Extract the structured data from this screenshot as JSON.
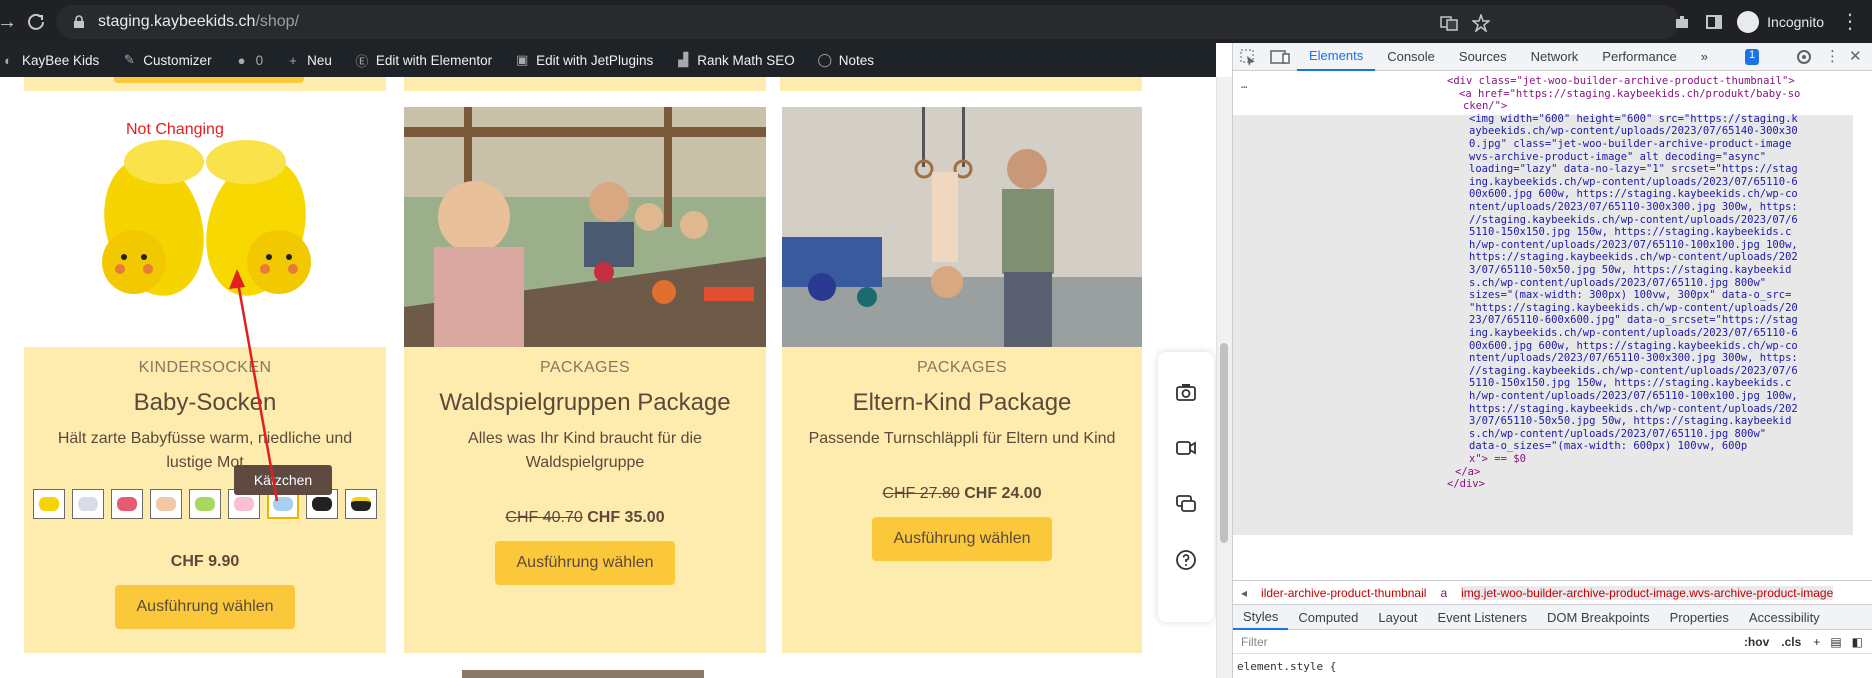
{
  "browser": {
    "url_host": "staging.kaybeekids.ch",
    "url_path": "/shop/",
    "profile_label": "Incognito"
  },
  "wp_admin_bar": {
    "items": [
      "KayBee Kids",
      "Customizer",
      "0",
      "Neu",
      "Edit with Elementor",
      "Edit with JetPlugins",
      "Rank Math SEO",
      "Notes"
    ]
  },
  "annotation": {
    "text": "Not Changing"
  },
  "tooltip": {
    "text": "Kätzchen"
  },
  "products": [
    {
      "category": "KINDERSOCKEN",
      "title": "Baby-Socken",
      "desc_line1": "Hält zarte Babyfüsse warm, niedliche und",
      "desc_line2": "lustige Mot",
      "price": "CHF 9.90",
      "button": "Ausführung wählen"
    },
    {
      "category": "PACKAGES",
      "title": "Waldspielgruppen Package",
      "desc_line1": "Alles was Ihr Kind braucht für die",
      "desc_line2": "Waldspielgruppe",
      "old_price": "CHF 40.70",
      "price": "CHF 35.00",
      "button": "Ausführung wählen"
    },
    {
      "category": "PACKAGES",
      "title": "Eltern-Kind Package",
      "desc_line1": "Passende Turnschläppli für Eltern und Kind",
      "old_price": "CHF 27.80",
      "price": "CHF 24.00",
      "button": "Ausführung wählen"
    }
  ],
  "devtools": {
    "tabs": [
      "Elements",
      "Console",
      "Sources",
      "Network",
      "Performance"
    ],
    "issues_count": "1",
    "code_lines": [
      "<div class=\"jet-woo-builder-archive-product-thumbnail\">",
      "<a href=\"https://staging.kaybeekids.ch/produkt/baby-so",
      "cken/\">",
      "<img width=\"600\" height=\"600\" src=\"https://staging.k",
      "aybeekids.ch/wp-content/uploads/2023/07/65140-300x30",
      "0.jpg\" class=\"jet-woo-builder-archive-product-image",
      "wvs-archive-product-image\" alt decoding=\"async\"",
      "loading=\"lazy\" data-no-lazy=\"1\" srcset=\"https://stag",
      "ing.kaybeekids.ch/wp-content/uploads/2023/07/65110-6",
      "00x600.jpg 600w, https://staging.kaybeekids.ch/wp-co",
      "ntent/uploads/2023/07/65110-300x300.jpg 300w, https:",
      "//staging.kaybeekids.ch/wp-content/uploads/2023/07/6",
      "5110-150x150.jpg 150w, https://staging.kaybeekids.c",
      "h/wp-content/uploads/2023/07/65110-100x100.jpg 100w,",
      "https://staging.kaybeekids.ch/wp-content/uploads/202",
      "3/07/65110-50x50.jpg 50w, https://staging.kaybeekid",
      "s.ch/wp-content/uploads/2023/07/65110.jpg 800w\"",
      "sizes=\"(max-width: 300px) 100vw, 300px\" data-o_src=",
      "\"https://staging.kaybeekids.ch/wp-content/uploads/20",
      "23/07/65110-600x600.jpg\" data-o_srcset=\"https://stag",
      "ing.kaybeekids.ch/wp-content/uploads/2023/07/65110-6",
      "00x600.jpg 600w, https://staging.kaybeekids.ch/wp-co",
      "ntent/uploads/2023/07/65110-300x300.jpg 300w, https:",
      "//staging.kaybeekids.ch/wp-content/uploads/2023/07/6",
      "5110-150x150.jpg 150w, https://staging.kaybeekids.c",
      "h/wp-content/uploads/2023/07/65110-100x100.jpg 100w,",
      "https://staging.kaybeekids.ch/wp-content/uploads/202",
      "3/07/65110-50x50.jpg 50w, https://staging.kaybeekid",
      "s.ch/wp-content/uploads/2023/07/65110.jpg 800w\"",
      "data-o_sizes=\"(max-width: 600px) 100vw, 600p",
      "x\"> == $0",
      "</a>",
      "</div>"
    ],
    "breadcrumbs": [
      "ilder-archive-product-thumbnail",
      "a",
      "img.jet-woo-builder-archive-product-image.wvs-archive-product-image"
    ],
    "subtabs": [
      "Styles",
      "Computed",
      "Layout",
      "Event Listeners",
      "DOM Breakpoints",
      "Properties",
      "Accessibility"
    ],
    "filter_placeholder": "Filter",
    "hov_label": ":hov",
    "cls_label": ".cls",
    "style_rule": "element.style {"
  }
}
